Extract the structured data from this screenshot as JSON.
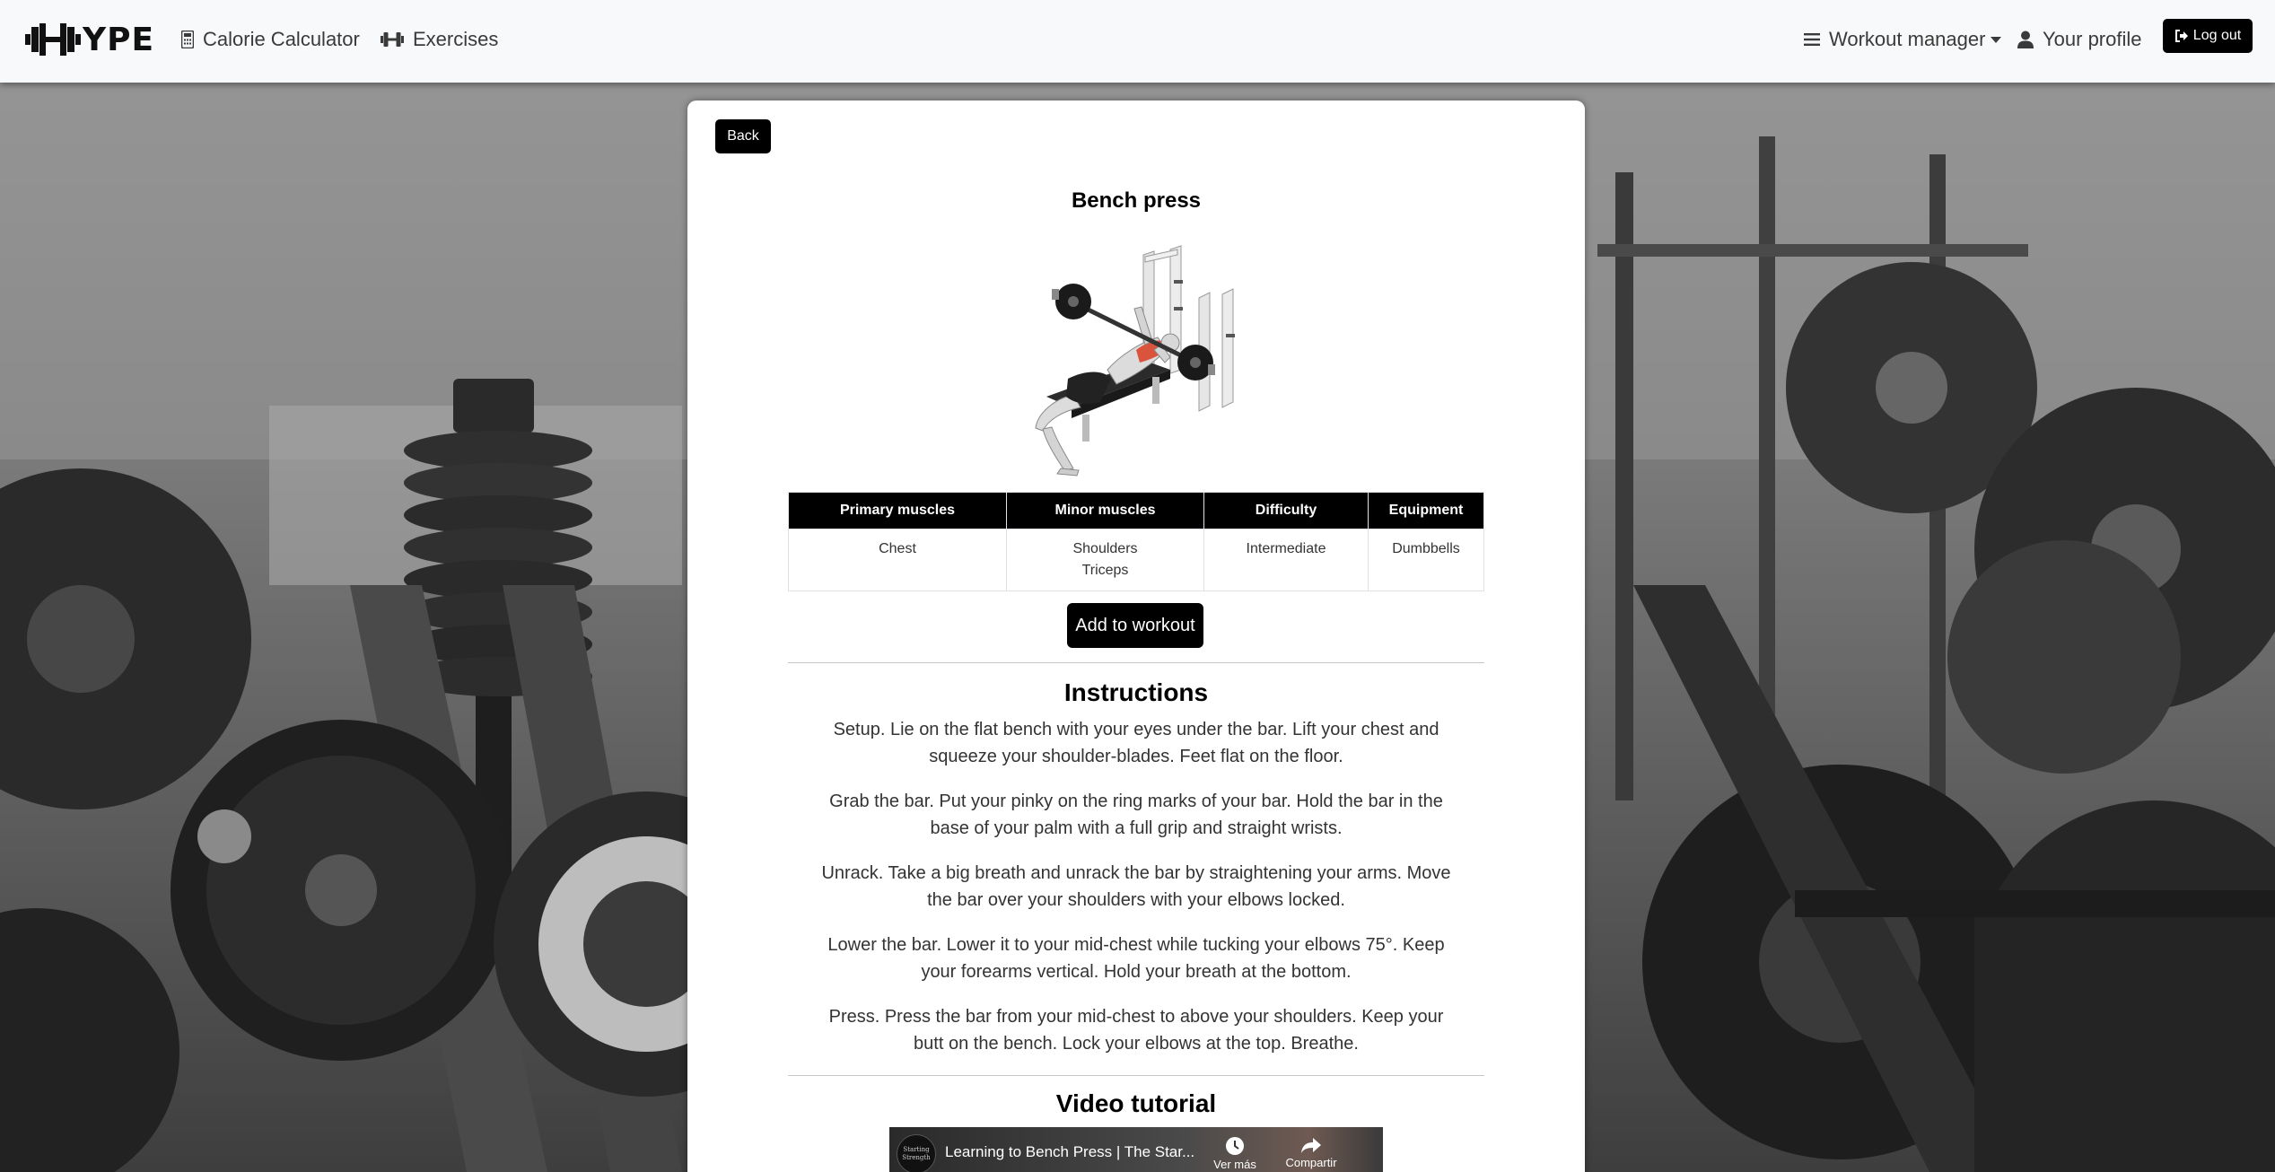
{
  "navbar": {
    "brand": "YPE",
    "links": {
      "calorie": "Calorie Calculator",
      "exercises": "Exercises",
      "workout_manager": "Workout manager",
      "profile": "Your profile",
      "logout": "Log out"
    }
  },
  "exercise": {
    "back_label": "Back",
    "title": "Bench press",
    "table": {
      "headers": [
        "Primary muscles",
        "Minor muscles",
        "Difficulty",
        "Equipment"
      ],
      "primary_muscles": [
        "Chest"
      ],
      "minor_muscles": [
        "Shoulders",
        "Triceps"
      ],
      "difficulty": "Intermediate",
      "equipment": "Dumbbells"
    },
    "add_label": "Add to workout",
    "instructions_heading": "Instructions",
    "instructions": [
      "Setup. Lie on the flat bench with your eyes under the bar. Lift your chest and squeeze your shoulder-blades. Feet flat on the floor.",
      "Grab the bar. Put your pinky on the ring marks of your bar. Hold the bar in the base of your palm with a full grip and straight wrists.",
      "Unrack. Take a big breath and unrack the bar by straightening your arms. Move the bar over your shoulders with your elbows locked.",
      "Lower the bar. Lower it to your mid-chest while tucking your elbows 75°. Keep your forearms vertical. Hold your breath at the bottom.",
      "Press. Press the bar from your mid-chest to above your shoulders. Keep your butt on the bench. Lock your elbows at the top. Breathe."
    ],
    "video_heading": "Video tutorial",
    "video": {
      "channel": "Starting Strength",
      "title": "Learning to Bench Press | The Star...",
      "watch_later": "Ver más tarde",
      "share": "Compartir"
    }
  },
  "icons": {
    "brand": "barbell-icon",
    "calorie": "calculator-icon",
    "exercises": "dumbbell-icon",
    "workout_manager": "hamburger-icon",
    "profile": "user-icon",
    "logout": "sign-out-icon"
  },
  "colors": {
    "navbar_bg": "#f8f9fa",
    "button_bg": "#000000",
    "table_header_bg": "#000000",
    "card_bg": "#ffffff"
  }
}
